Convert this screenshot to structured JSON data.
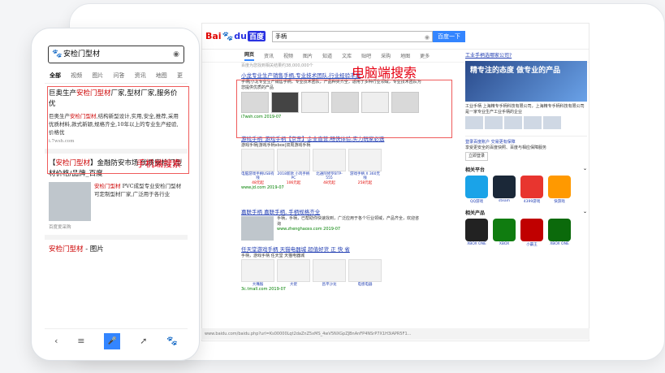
{
  "pc": {
    "logo_text": "Bai",
    "logo_du": "du",
    "logo_cn": "百度",
    "search_value": "手柄",
    "search_button": "百度一下",
    "tabs": [
      "网页",
      "资讯",
      "视频",
      "图片",
      "知道",
      "文库",
      "贴吧",
      "采购",
      "地图",
      "更多"
    ],
    "result_count": "百度为您找到相关结果约38,000,000个",
    "label": "电脑端搜索",
    "results": [
      {
        "title": "小龙专业生产销售手柄,专业技术团队,行业经验丰富",
        "text": "手柄|小龙专业生产销售手柄，专业技术团队，产品种类齐全，适用于多种行业领域，专业技术团队为您提供优质的产品",
        "url": "i7wsh.com 2019-07"
      },
      {
        "title": "游戏手柄_游戏手柄【京东】企业直营,畅快体验,实力玩家必选",
        "text": "游戏手柄|游戏手柄xbox|双周游戏手柄",
        "url": "www.jd.com 2019-07"
      },
      {
        "title": "嘉联手柄 嘉联手柄, 手柄规格齐全",
        "text": "手柄，手柄，已帮助你快速找到，广泛应用于各个行业领域，产品齐全，欢迎咨询",
        "url": "www.zhenghaoxs.com 2019-07"
      },
      {
        "title": "任天堂游戏手柄 天猫电器城 超值好货 正 快 省",
        "text": "手柄，游戏手柄 任天堂 天猫电器城",
        "url": "3c.tmall.com 2019-07"
      }
    ],
    "products": [
      {
        "name": "电脑游戏手柄USB有线",
        "price": "48元起"
      },
      {
        "name": "2018新款 小鸡手柄 PC",
        "price": "106元起"
      },
      {
        "name": "北通阿修罗BTP-555",
        "price": "48元起"
      },
      {
        "name": "游戏手柄 X 360无线",
        "price": "258元起"
      }
    ],
    "tmall": [
      {
        "name": "大嘴猴",
        "price": ""
      },
      {
        "name": "大佬",
        "price": ""
      },
      {
        "name": "昌平沙龙",
        "price": ""
      },
      {
        "name": "电感电器",
        "price": ""
      }
    ],
    "right": {
      "title": "工业手柄选哪家公司?",
      "banner": "精专注的态度 做专业的产品",
      "text": "工业手柄 上海精专手柄科技有限公司，上海精专手柄科技有限公司是一家专业生产工业手柄的企业",
      "secure_title": "登录百度账户 交易更有保障",
      "secure_text": "享受更安全的百度快照、百度与相应保障服务",
      "login_button": "立即登录",
      "related_platform": "相关平台",
      "related_products": "相关产品",
      "apps": [
        {
          "name": "QQ游戏",
          "color": "#1aa3e8"
        },
        {
          "name": "steam",
          "color": "#1b2838"
        },
        {
          "name": "4399游戏",
          "color": "#e8352f"
        },
        {
          "name": "快游戏",
          "color": "#ff9900"
        }
      ],
      "products": [
        {
          "name": "XBOX ONE",
          "color": "#222222"
        },
        {
          "name": "XBOX",
          "color": "#107c10"
        },
        {
          "name": "小霸王",
          "color": "#c00000"
        },
        {
          "name": "XBOX ONE",
          "color": "#0b6a0b"
        }
      ]
    },
    "url_bar": "www.baidu.com/baidu.php?url=Ks00000Lqt2daZnZ5xMS_4wV5NXGpZJBnAnFP4NSrP7X1H3iAPR5F1..."
  },
  "mobile": {
    "search_value": "安检门型材",
    "tabs": [
      "全部",
      "视频",
      "图片",
      "问答",
      "资讯",
      "地图",
      "更"
    ],
    "label": "手机端搜索",
    "card1": {
      "title_a": "巨奥生产",
      "title_hl": "安检门型材",
      "title_b": "厂家,型材厂家,服务价优",
      "text_a": "巨奥生产",
      "text_hl": "安检门型材",
      "text_b": ",结构新型设计,实用,安全,推荐,采用优质材料,款式新颖,规格齐全,10年以上的专业生产经验,价格优",
      "url": "i.7wsh.com"
    },
    "card2": {
      "title_a": "【",
      "title_hl": "安检门型材",
      "title_b": "】金融防安市场 优质安检门型材价格/品牌_百度",
      "text_a": "",
      "text_hl": "安检门型材",
      "text_b": " PVC成型专业安检门型材 可定制型材厂家,广泛用于各行业",
      "url": "百度爱采购"
    },
    "card3_title_hl": "安检门型材",
    "card3_title_b": " - 图片",
    "nav": [
      "‹",
      "≡",
      "🎤",
      "➚",
      "🐾"
    ]
  }
}
